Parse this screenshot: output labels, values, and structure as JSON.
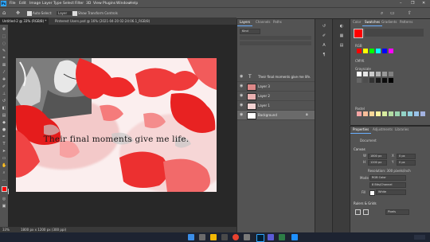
{
  "app": {
    "menus": [
      "File",
      "Edit",
      "Image",
      "Layer",
      "Type",
      "Select",
      "Filter",
      "3D",
      "View",
      "Plugins",
      "Window",
      "Help"
    ],
    "window_controls": [
      "–",
      "❐",
      "✕"
    ]
  },
  "options_bar": {
    "auto_select_label": "Auto-Select:",
    "auto_select_target": "Layer",
    "show_transform_label": "Show Transform Controls"
  },
  "tabs": [
    {
      "label": "Untitled-2 @ 33% (RGB/8) *",
      "active": true
    },
    {
      "label": "Pinterest Users.psd @ 16% (2021-04-20 02:24:06.1_RGB/8)",
      "active": false
    }
  ],
  "canvas": {
    "caption": "Their final moments give me life."
  },
  "status": {
    "zoom": "33%",
    "doc_size": "1800 px x 1200 px (300 ppi)"
  },
  "layers_panel": {
    "tabs": [
      "Layers",
      "Channels",
      "Paths"
    ],
    "search_label": "Kind",
    "layers": [
      {
        "name": "Their final moments give me life.",
        "type": "text"
      },
      {
        "name": "Layer 3",
        "type": "image"
      },
      {
        "name": "Layer 2",
        "type": "image"
      },
      {
        "name": "Layer 1",
        "type": "image"
      },
      {
        "name": "Background",
        "type": "background"
      }
    ]
  },
  "swatches_panel": {
    "tabs": [
      "Color",
      "Swatches",
      "Gradients",
      "Patterns"
    ],
    "groups": [
      "RGB",
      "CMYK",
      "Grayscale",
      "Pastel"
    ],
    "colors": {
      "rgb": [
        "#ff0000",
        "#ffff00",
        "#00ff00",
        "#00ffff",
        "#0000ff",
        "#ff00ff"
      ],
      "grayscale": [
        "#ffffff",
        "#e6e6e6",
        "#cccccc",
        "#b3b3b3",
        "#999999",
        "#808080",
        "#666666",
        "#4d4d4d",
        "#333333",
        "#1a1a1a",
        "#0d0d0d",
        "#000000"
      ],
      "pastel": [
        "#f4a4a4",
        "#f7bd9a",
        "#fbd899",
        "#fff3a0",
        "#d7eb9f",
        "#b3dda3",
        "#9bd6b0",
        "#93d3c7",
        "#92d1dd",
        "#99c3e9",
        "#a3b2e0"
      ]
    }
  },
  "properties_panel": {
    "tabs": [
      "Properties",
      "Adjustments",
      "Libraries"
    ],
    "document_label": "Document",
    "canvas_section": "Canvas",
    "width_label": "W",
    "width_value": "1800 px",
    "height_label": "H",
    "height_value": "1200 px",
    "x_label": "X",
    "y_label": "Y",
    "x_value": "0 px",
    "y_value": "0 px",
    "resolution": "Resolution: 300 pixels/inch",
    "mode_label": "Mode",
    "mode_value": "RGB Color",
    "depth_value": "8 Bits/Channel",
    "fill_label": "Fill",
    "fill_value": "White",
    "rulers_section": "Rulers & Grids",
    "units_value": "Pixels"
  },
  "accent": "#31a8ff",
  "foreground_color": "#ff0000",
  "background_color": "#ffffff"
}
